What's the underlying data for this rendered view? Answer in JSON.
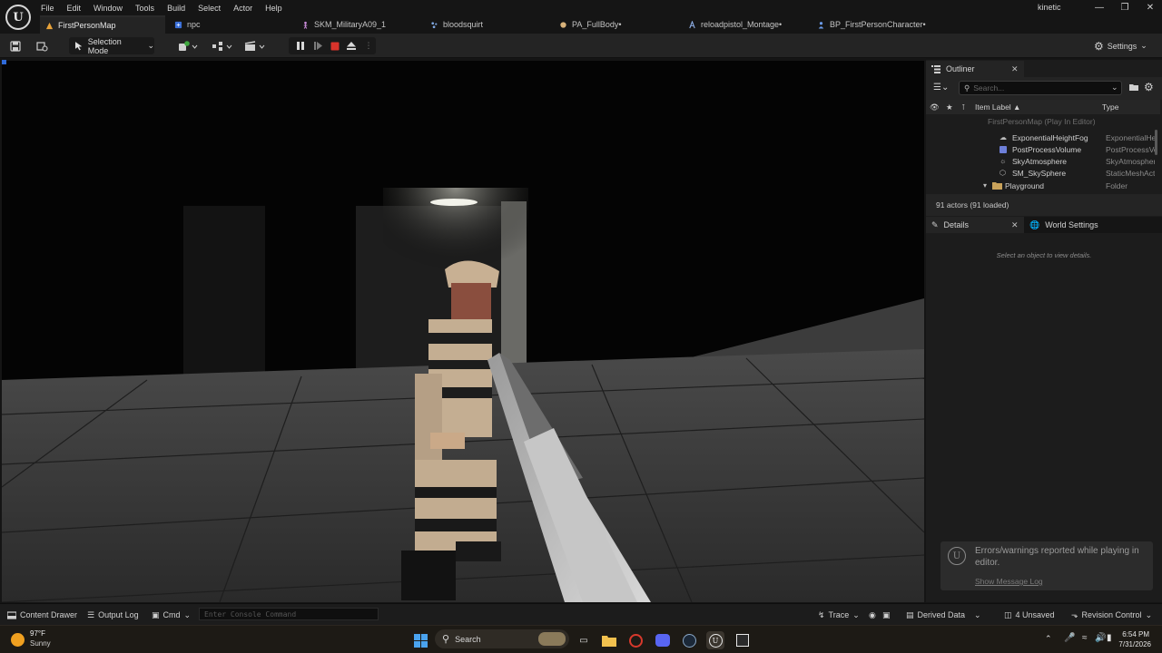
{
  "app": {
    "logo_text": "U",
    "user": "kinetic"
  },
  "menu": [
    "File",
    "Edit",
    "Window",
    "Tools",
    "Build",
    "Select",
    "Actor",
    "Help"
  ],
  "tabs": [
    {
      "label": "FirstPersonMap",
      "icon": "level-icon",
      "active": true
    },
    {
      "label": "npc",
      "icon": "blueprint-icon"
    },
    {
      "label": "SKM_MilitaryA09_1",
      "icon": "skeletal-mesh-icon"
    },
    {
      "label": "bloodsquirt",
      "icon": "niagara-icon"
    },
    {
      "label": "PA_FullBody•",
      "icon": "physics-asset-icon"
    },
    {
      "label": "reloadpistol_Montage•",
      "icon": "montage-icon"
    },
    {
      "label": "BP_FirstPersonCharacter•",
      "icon": "blueprint-icon"
    }
  ],
  "toolbar": {
    "selection_mode": "Selection Mode",
    "settings": "Settings"
  },
  "outliner": {
    "tab_label": "Outliner",
    "search_placeholder": "Search...",
    "col_label": "Item Label ▲",
    "col_type": "Type",
    "rows": [
      {
        "label": "FirstPersonMap (Play In Editor)",
        "type": "",
        "dim": true
      },
      {
        "label": "ExponentialHeightFog",
        "type": "ExponentialHeightFog"
      },
      {
        "label": "PostProcessVolume",
        "type": "PostProcessVolume"
      },
      {
        "label": "SkyAtmosphere",
        "type": "SkyAtmosphere"
      },
      {
        "label": "SM_SkySphere",
        "type": "StaticMeshActor"
      },
      {
        "label": "Playground",
        "type": "Folder"
      }
    ],
    "actor_count": "91 actors (91 loaded)"
  },
  "details": {
    "tab_label": "Details",
    "world_settings_label": "World Settings",
    "empty_message": "Select an object to view details."
  },
  "notification": {
    "message": "Errors/warnings reported while playing in editor.",
    "link": "Show Message Log"
  },
  "statusbar": {
    "content_drawer": "Content Drawer",
    "output_log": "Output Log",
    "cmd": "Cmd",
    "console_placeholder": "Enter Console Command",
    "trace": "Trace",
    "derived_data": "Derived Data",
    "unsaved": "4 Unsaved",
    "revision_control": "Revision Control"
  },
  "taskbar": {
    "weather_temp": "97°F",
    "weather_desc": "Sunny",
    "search_label": "Search",
    "time": "6:54 PM",
    "date": "7/31/2026"
  },
  "colors": {
    "accent_orange": "#e8a33a",
    "stop_red": "#d9332b",
    "panel_bg": "#1c1c1c",
    "toolbar_bg": "#242424"
  }
}
